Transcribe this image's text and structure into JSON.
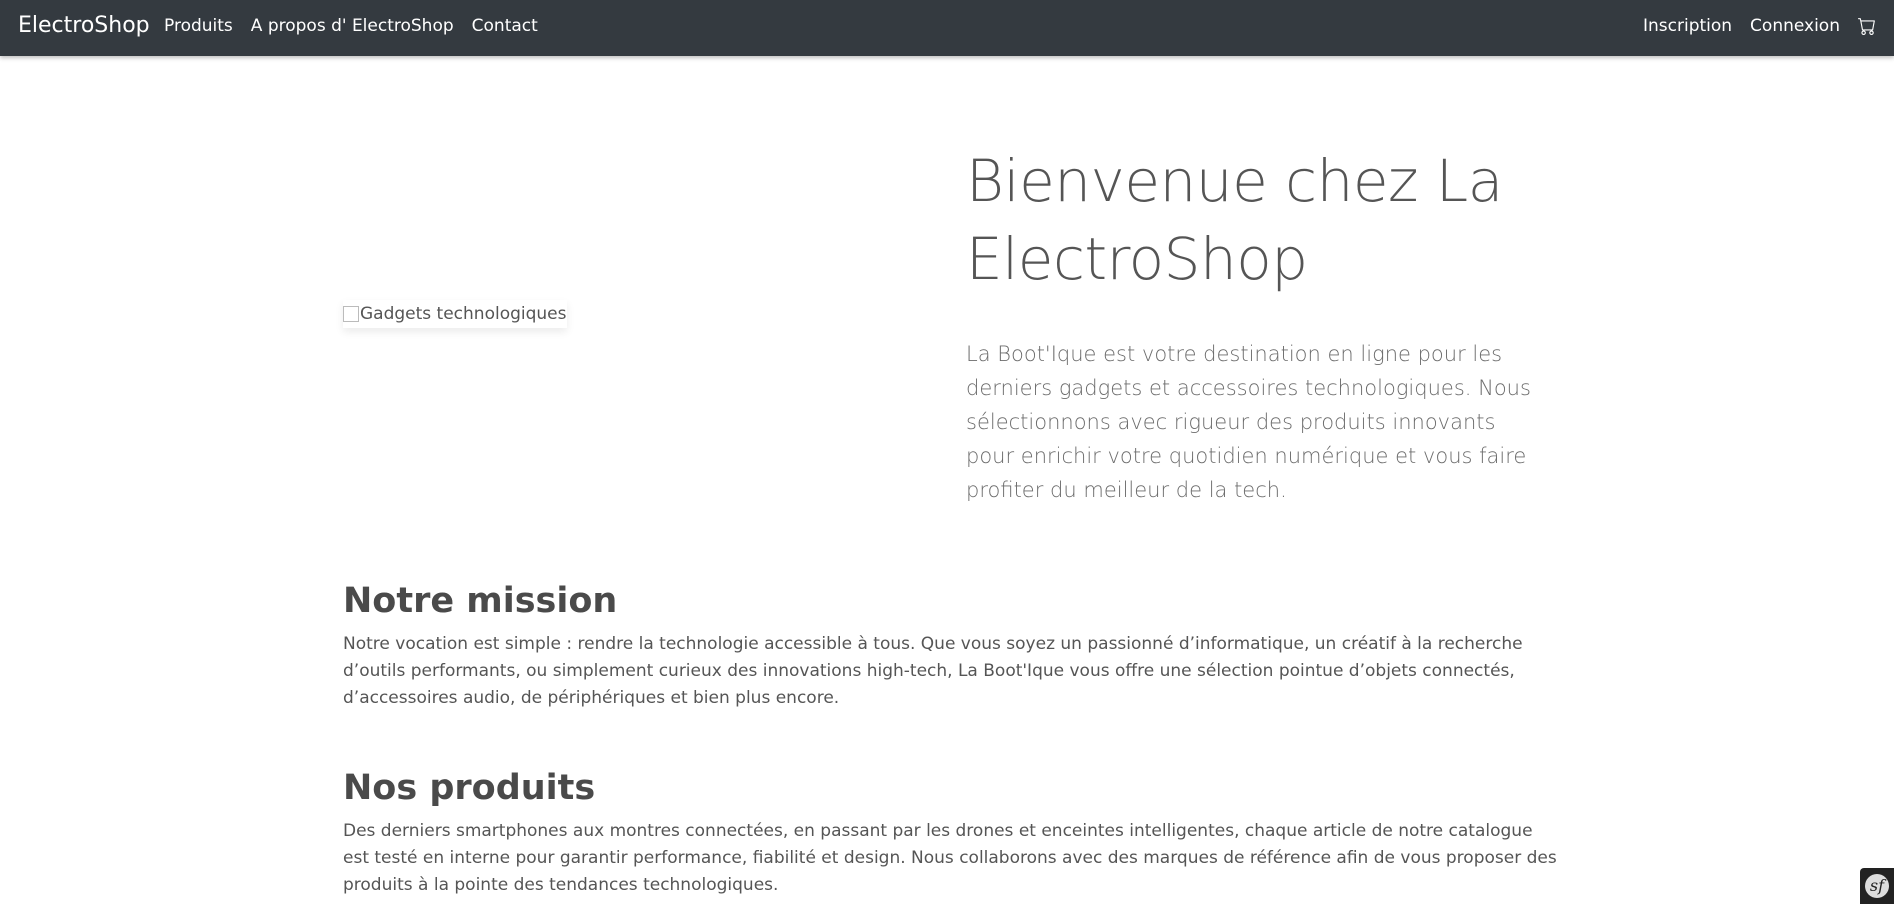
{
  "navbar": {
    "brand": "ElectroShop",
    "links_left": [
      "Produits",
      "A propos d' ElectroShop",
      "Contact"
    ],
    "links_right": [
      "Inscription",
      "Connexion"
    ],
    "cart_icon": "cart-icon",
    "background": "#343a40"
  },
  "hero": {
    "image_alt": "Gadgets technologiques",
    "title": "Bienvenue chez La ElectroShop",
    "lead": "La Boot'Ique est votre destination en ligne pour les derniers gadgets et accessoires technologiques. Nous sélectionnons avec rigueur des produits innovants pour enrichir votre quotidien numérique et vous faire profiter du meilleur de la tech."
  },
  "sections": [
    {
      "title": "Notre mission",
      "text": "Notre vocation est simple : rendre la technologie accessible à tous. Que vous soyez un passionné d’informatique, un créatif à la recherche d’outils performants, ou simplement curieux des innovations high-tech, La Boot'Ique vous offre une sélection pointue d’objets connectés, d’accessoires audio, de périphériques et bien plus encore."
    },
    {
      "title": "Nos produits",
      "text": "Des derniers smartphones aux montres connectées, en passant par les drones et enceintes intelligentes, chaque article de notre catalogue est testé en interne pour garantir performance, fiabilité et design. Nous collaborons avec des marques de référence afin de vous proposer des produits à la pointe des tendances technologiques."
    }
  ],
  "debug_toolbar": {
    "icon": "symfony-icon",
    "glyph": "sf"
  }
}
